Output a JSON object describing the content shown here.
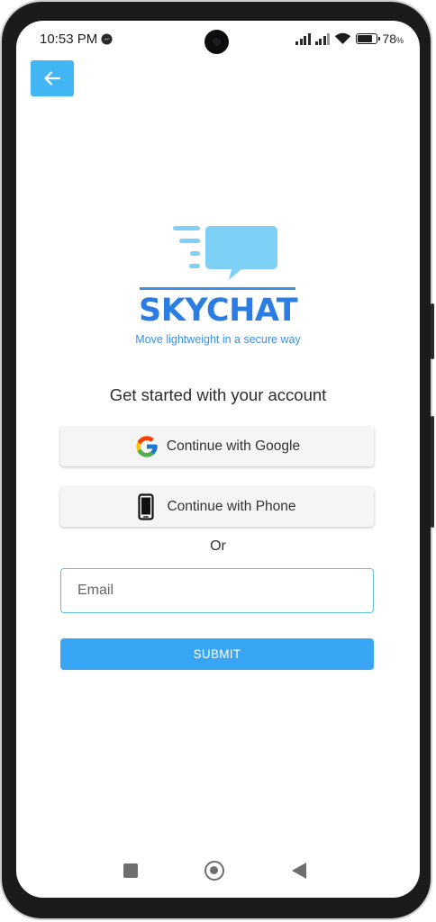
{
  "status_bar": {
    "time": "10:53 PM",
    "battery_text": "78",
    "battery_unit": "%",
    "battery_level": 0.78,
    "icons": [
      "messenger-icon",
      "signal-icon",
      "signal-icon",
      "wifi-icon",
      "battery-icon"
    ]
  },
  "header": {
    "back_icon": "arrow-left-icon",
    "back_color": "#42b6f3"
  },
  "brand": {
    "name": "SKYCHAT",
    "tagline": "Move lightweight in a secure way",
    "color": "#2a7ee3",
    "accent": "#7fd0f7"
  },
  "auth": {
    "heading": "Get started with your account",
    "google_label": "Continue with Google",
    "phone_label": "Continue with Phone",
    "separator": "Or",
    "email_placeholder": "Email",
    "submit_label": "SUBMIT",
    "submit_color": "#38a6f5"
  },
  "nav_bar": {
    "icons": [
      "recents-icon",
      "home-icon",
      "back-icon"
    ]
  }
}
